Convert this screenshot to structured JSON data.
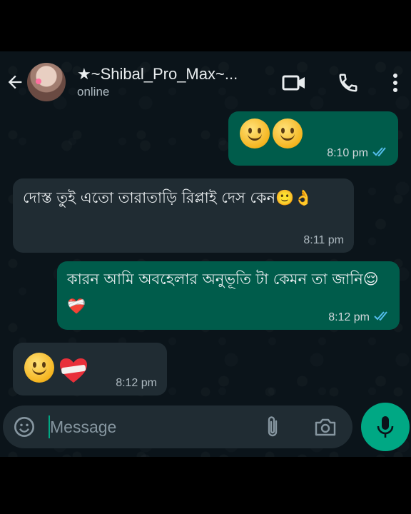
{
  "header": {
    "contact_name": "★~Shibal_Pro_Max~...",
    "status": "online"
  },
  "messages": [
    {
      "direction": "outgoing",
      "text": "🙂🙂",
      "time": "8:10 pm",
      "ticks": "read"
    },
    {
      "direction": "incoming",
      "text": "দোস্ত তুই এতো তারাতাড়ি রিপ্লাই দেস কেন🙂👌",
      "time": "8:11 pm"
    },
    {
      "direction": "outgoing",
      "text": "কারন আমি অবহেলার অনুভূতি টা কেমন তা জানি😌❤️‍🩹",
      "time": "8:12 pm",
      "ticks": "read"
    },
    {
      "direction": "incoming",
      "text": "🙂❤️‍🩹",
      "time": "8:12 pm"
    }
  ],
  "input": {
    "placeholder": "Message"
  },
  "colors": {
    "outgoing_bubble": "#005c4b",
    "incoming_bubble": "#202c33",
    "accent": "#00a884",
    "read_tick": "#53bdeb"
  },
  "icons": [
    "back-arrow-icon",
    "video-call-icon",
    "voice-call-icon",
    "more-options-icon",
    "sticker-icon",
    "attach-icon",
    "camera-icon",
    "mic-icon"
  ]
}
